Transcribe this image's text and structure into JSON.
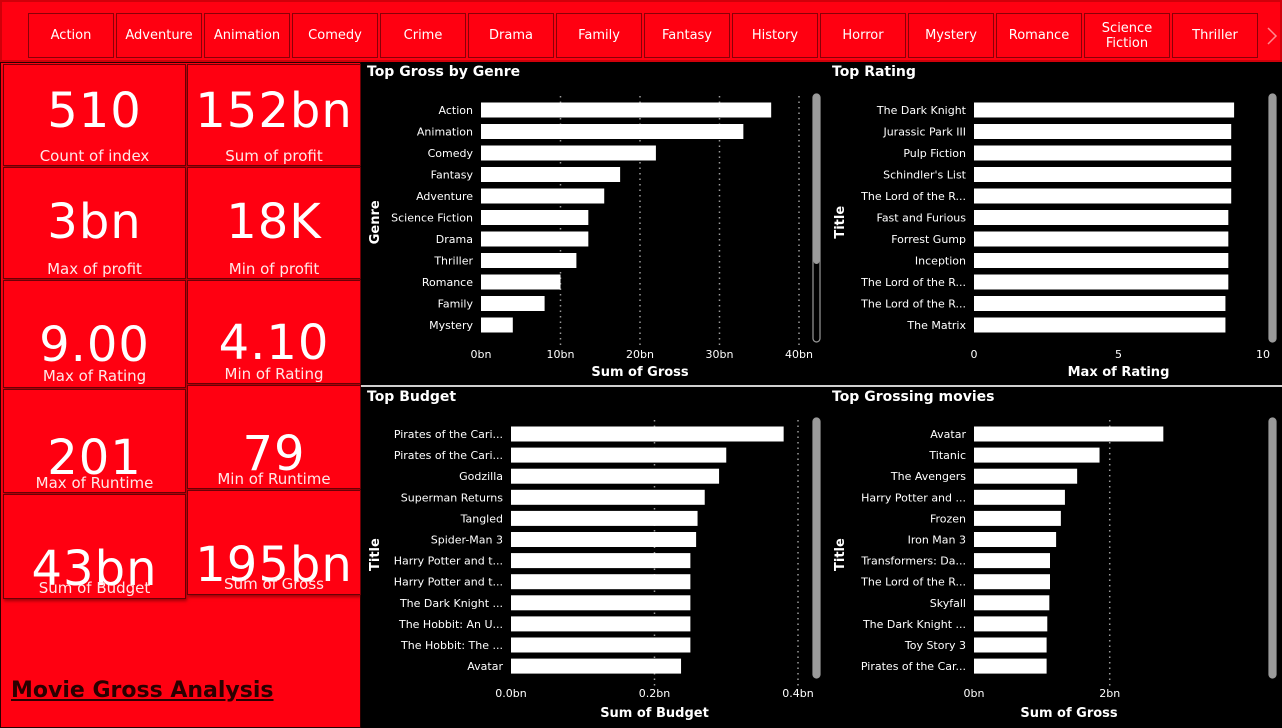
{
  "colors": {
    "accent": "#ff0011",
    "background": "#000000",
    "bar": "#ffffff",
    "scrollbar": "#9a9a9a"
  },
  "slicer": {
    "genres": [
      "Action",
      "Adventure",
      "Animation",
      "Comedy",
      "Crime",
      "Drama",
      "Family",
      "Fantasy",
      "History",
      "Horror",
      "Mystery",
      "Romance",
      "Science Fiction",
      "Thriller"
    ],
    "next_icon": "chevron-right-icon"
  },
  "kpis": [
    {
      "value": "510",
      "label": "Count of index"
    },
    {
      "value": "152bn",
      "label": "Sum of profit"
    },
    {
      "value": "3bn",
      "label": "Max of profit"
    },
    {
      "value": "18K",
      "label": "Min of profit"
    },
    {
      "value": "9.00",
      "label": "Max of Rating"
    },
    {
      "value": "4.10",
      "label": "Min of Rating"
    },
    {
      "value": "201",
      "label": "Max of Runtime"
    },
    {
      "value": "79",
      "label": "Min of Runtime"
    },
    {
      "value": "43bn",
      "label": "Sum of Budget"
    },
    {
      "value": "195bn",
      "label": "Sum of Gross"
    }
  ],
  "report_title": "Movie Gross Analysis",
  "chart_data": [
    {
      "type": "bar",
      "title": "Top Gross by Genre",
      "xlabel": "Sum of Gross",
      "ylabel": "Genre",
      "categories": [
        "Action",
        "Animation",
        "Comedy",
        "Fantasy",
        "Adventure",
        "Science Fiction",
        "Drama",
        "Thriller",
        "Romance",
        "Family",
        "Mystery"
      ],
      "values": [
        36.5,
        33,
        22,
        17.5,
        15.5,
        13.5,
        13.5,
        12,
        10,
        8,
        4
      ],
      "xlim": [
        0,
        40
      ],
      "ticks": [
        "0bn",
        "10bn",
        "20bn",
        "30bn",
        "40bn"
      ],
      "grid": true
    },
    {
      "type": "bar",
      "title": "Top Rating",
      "xlabel": "Max of Rating",
      "ylabel": "Title",
      "categories": [
        "The Dark Knight",
        "Jurassic Park III",
        "Pulp Fiction",
        "Schindler's List",
        "The Lord of the R...",
        "Fast and Furious",
        "Forrest Gump",
        "Inception",
        "The Lord of the R...",
        "The Lord of the R...",
        "The Matrix"
      ],
      "values": [
        9.0,
        8.9,
        8.9,
        8.9,
        8.9,
        8.8,
        8.8,
        8.8,
        8.8,
        8.7,
        8.7
      ],
      "xlim": [
        0,
        10
      ],
      "ticks": [
        "0",
        "5",
        "10"
      ],
      "grid": false
    },
    {
      "type": "bar",
      "title": "Top Budget",
      "xlabel": "Sum of Budget",
      "ylabel": "Title",
      "categories": [
        "Pirates of the Cari...",
        "Pirates of the Cari...",
        "Godzilla",
        "Superman Returns",
        "Tangled",
        "Spider-Man 3",
        "Harry Potter and t...",
        "Harry Potter and t...",
        "The Dark Knight ...",
        "The Hobbit: An U...",
        "The Hobbit: The ...",
        "Avatar"
      ],
      "values": [
        0.38,
        0.3,
        0.29,
        0.27,
        0.26,
        0.258,
        0.25,
        0.25,
        0.25,
        0.25,
        0.25,
        0.237
      ],
      "xlim": [
        0,
        0.4
      ],
      "ticks": [
        "0.0bn",
        "0.2bn",
        "0.4bn"
      ],
      "grid": true
    },
    {
      "type": "bar",
      "title": "Top Grossing movies",
      "xlabel": "Sum of Gross",
      "ylabel": "Title",
      "categories": [
        "Avatar",
        "Titanic",
        "The Avengers",
        "Harry Potter and ...",
        "Frozen",
        "Iron Man 3",
        "Transformers: Da...",
        "The Lord of the R...",
        "Skyfall",
        "The Dark Knight ...",
        "Toy Story 3",
        "Pirates of the Car..."
      ],
      "values": [
        2.79,
        1.85,
        1.52,
        1.34,
        1.28,
        1.21,
        1.12,
        1.12,
        1.11,
        1.08,
        1.07,
        1.07
      ],
      "xlim": [
        0,
        2.8
      ],
      "ticks": [
        "0bn",
        "2bn"
      ],
      "tick_values": [
        0,
        2
      ],
      "grid": true
    }
  ]
}
